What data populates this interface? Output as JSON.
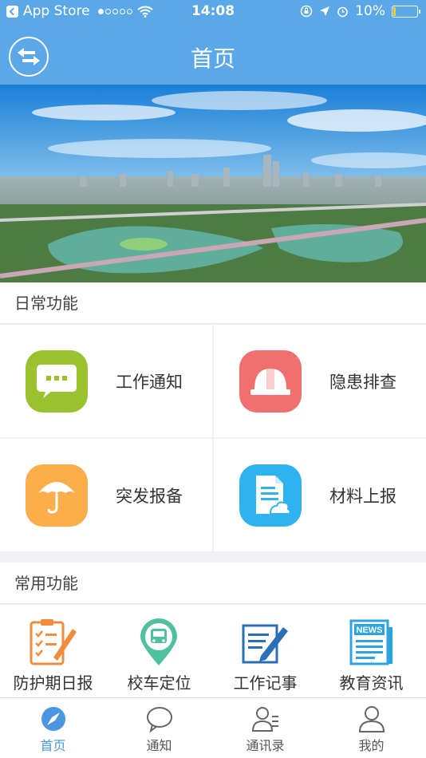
{
  "status_bar": {
    "carrier": "App Store",
    "time": "14:08",
    "battery": "10%",
    "battery_level": 0.1
  },
  "nav": {
    "title": "首页",
    "swap_icon": "swap-arrows-icon"
  },
  "sections": {
    "daily": "日常功能",
    "common": "常用功能"
  },
  "daily_functions": [
    {
      "label": "工作通知",
      "icon": "message-bubble-icon",
      "color": "#9ac12e"
    },
    {
      "label": "隐患排查",
      "icon": "helmet-icon",
      "color": "#f0706f"
    },
    {
      "label": "突发报备",
      "icon": "umbrella-icon",
      "color": "#fcae4a"
    },
    {
      "label": "材料上报",
      "icon": "document-cloud-icon",
      "color": "#2fb3ee"
    }
  ],
  "common_functions": [
    {
      "label": "防护期日报",
      "icon": "checklist-icon"
    },
    {
      "label": "校车定位",
      "icon": "bus-location-icon"
    },
    {
      "label": "工作记事",
      "icon": "note-edit-icon"
    },
    {
      "label": "教育资讯",
      "icon": "news-icon"
    }
  ],
  "news_icon_text": "NEWS",
  "tabs": [
    {
      "label": "首页",
      "icon": "compass-icon",
      "active": true
    },
    {
      "label": "通知",
      "icon": "chat-bubble-icon",
      "active": false
    },
    {
      "label": "通讯录",
      "icon": "contacts-icon",
      "active": false
    },
    {
      "label": "我的",
      "icon": "user-icon",
      "active": false
    }
  ],
  "colors": {
    "primary": "#5aa8e8",
    "tab_active": "#4a97e0"
  }
}
